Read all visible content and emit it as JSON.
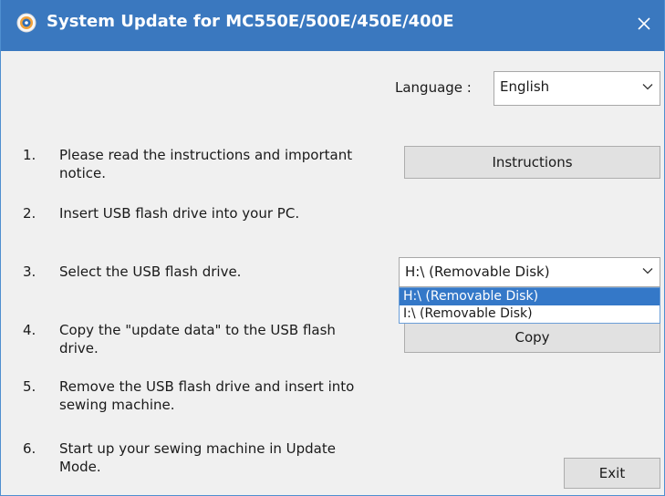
{
  "window": {
    "title": "System Update for MC550E/500E/450E/400E",
    "app_icon": "update-disc-icon",
    "close_icon": "close-icon"
  },
  "language": {
    "label": "Language :",
    "selected": "English"
  },
  "steps": [
    {
      "number": "1.",
      "text": "Please read the instructions and important notice."
    },
    {
      "number": "2.",
      "text": "Insert USB flash drive into your PC."
    },
    {
      "number": "3.",
      "text": "Select the USB flash drive."
    },
    {
      "number": "4.",
      "text": "Copy the \"update data\" to the USB flash drive."
    },
    {
      "number": "5.",
      "text": "Remove the USB flash drive and insert into sewing machine."
    },
    {
      "number": "6.",
      "text": "Start up your sewing machine in Update Mode."
    }
  ],
  "buttons": {
    "instructions": "Instructions",
    "copy": "Copy",
    "exit": "Exit"
  },
  "usb_drive": {
    "selected": "H:\\ (Removable Disk)",
    "options": [
      "H:\\ (Removable Disk)",
      "I:\\ (Removable Disk)"
    ],
    "highlighted_option": "H:\\ (Removable Disk)"
  },
  "colors": {
    "titlebar": "#3a78bf",
    "dialog_background": "#f0f0f0",
    "selection_highlight": "#3478c8"
  }
}
